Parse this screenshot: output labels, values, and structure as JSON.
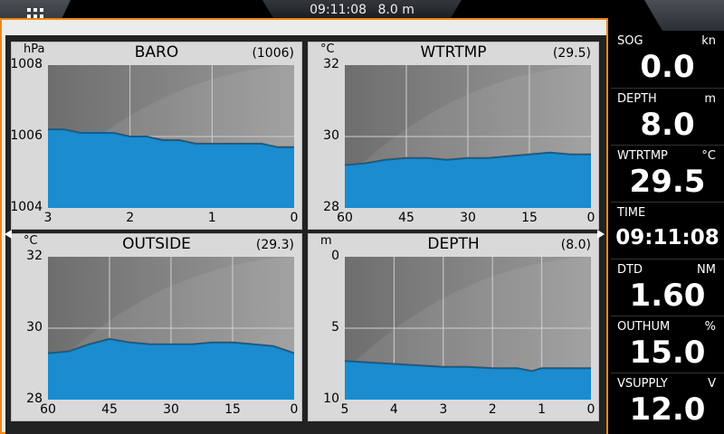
{
  "topbar": {
    "time": "09:11:08",
    "depth": "8.0 m"
  },
  "charts": [
    {
      "id": "baro",
      "title": "BARO",
      "unit": "hPa",
      "current": "(1006)",
      "yticks": [
        "1008",
        "1006",
        "1004"
      ],
      "xticks": [
        "3",
        "2",
        "1",
        "0"
      ]
    },
    {
      "id": "wtrtmp",
      "title": "WTRTMP",
      "unit": "°C",
      "current": "(29.5)",
      "yticks": [
        "32",
        "30",
        "28"
      ],
      "xticks": [
        "60",
        "45",
        "30",
        "15",
        "0"
      ]
    },
    {
      "id": "outside",
      "title": "OUTSIDE",
      "unit": "°C",
      "current": "(29.3)",
      "yticks": [
        "32",
        "30",
        "28"
      ],
      "xticks": [
        "60",
        "45",
        "30",
        "15",
        "0"
      ]
    },
    {
      "id": "depth",
      "title": "DEPTH",
      "unit": "m",
      "current": "(8.0)",
      "yticks": [
        "0",
        "5",
        "10"
      ],
      "xticks": [
        "5",
        "4",
        "3",
        "2",
        "1",
        "0"
      ]
    }
  ],
  "chart_data": [
    {
      "type": "area",
      "title": "BARO",
      "ylabel": "hPa",
      "ylim": [
        1004,
        1008
      ],
      "xlim": [
        3,
        0
      ],
      "x": [
        3,
        2.8,
        2.6,
        2.4,
        2.2,
        2,
        1.8,
        1.6,
        1.4,
        1.2,
        1,
        0.8,
        0.6,
        0.4,
        0.2,
        0
      ],
      "values": [
        1006.2,
        1006.2,
        1006.1,
        1006.1,
        1006.1,
        1006.0,
        1006.0,
        1005.9,
        1005.9,
        1005.8,
        1005.8,
        1005.8,
        1005.8,
        1005.8,
        1005.7,
        1005.7
      ]
    },
    {
      "type": "area",
      "title": "WTRTMP",
      "ylabel": "°C",
      "ylim": [
        28,
        32
      ],
      "xlim": [
        60,
        0
      ],
      "x": [
        60,
        55,
        50,
        45,
        40,
        35,
        30,
        25,
        20,
        15,
        10,
        5,
        0
      ],
      "values": [
        29.2,
        29.25,
        29.35,
        29.4,
        29.4,
        29.35,
        29.4,
        29.4,
        29.45,
        29.5,
        29.55,
        29.5,
        29.5
      ]
    },
    {
      "type": "area",
      "title": "OUTSIDE",
      "ylabel": "°C",
      "ylim": [
        28,
        32
      ],
      "xlim": [
        60,
        0
      ],
      "x": [
        60,
        55,
        50,
        45,
        40,
        35,
        30,
        25,
        20,
        15,
        10,
        5,
        0
      ],
      "values": [
        29.3,
        29.35,
        29.55,
        29.7,
        29.6,
        29.55,
        29.55,
        29.55,
        29.6,
        29.6,
        29.55,
        29.5,
        29.3
      ]
    },
    {
      "type": "area",
      "title": "DEPTH",
      "ylabel": "m",
      "ylim": [
        0,
        10
      ],
      "inverted": true,
      "xlim": [
        5,
        0
      ],
      "x": [
        5,
        4.5,
        4,
        3.5,
        3,
        2.5,
        2,
        1.5,
        1.2,
        1,
        0.5,
        0
      ],
      "values": [
        7.3,
        7.4,
        7.5,
        7.6,
        7.7,
        7.7,
        7.8,
        7.8,
        8.0,
        7.8,
        7.8,
        7.8
      ]
    }
  ],
  "datacol": [
    {
      "label": "SOG",
      "unit": "kn",
      "value": "0.0"
    },
    {
      "label": "DEPTH",
      "unit": "m",
      "value": "8.0"
    },
    {
      "label": "WTRTMP",
      "unit": "°C",
      "value": "29.5"
    },
    {
      "label": "TIME",
      "unit": "",
      "value": "09:11:08"
    },
    {
      "label": "DTD",
      "unit": "NM",
      "value": "1.60"
    },
    {
      "label": "OUTHUM",
      "unit": "%",
      "value": "15.0"
    },
    {
      "label": "VSUPPLY",
      "unit": "V",
      "value": "12.0"
    }
  ],
  "colors": {
    "accent": "#e98a1a",
    "fill": "#1a8ccf",
    "line": "#0e5f91",
    "plot_bg_dark": "#6e6e6e",
    "plot_bg_light": "#9a9a9a"
  }
}
